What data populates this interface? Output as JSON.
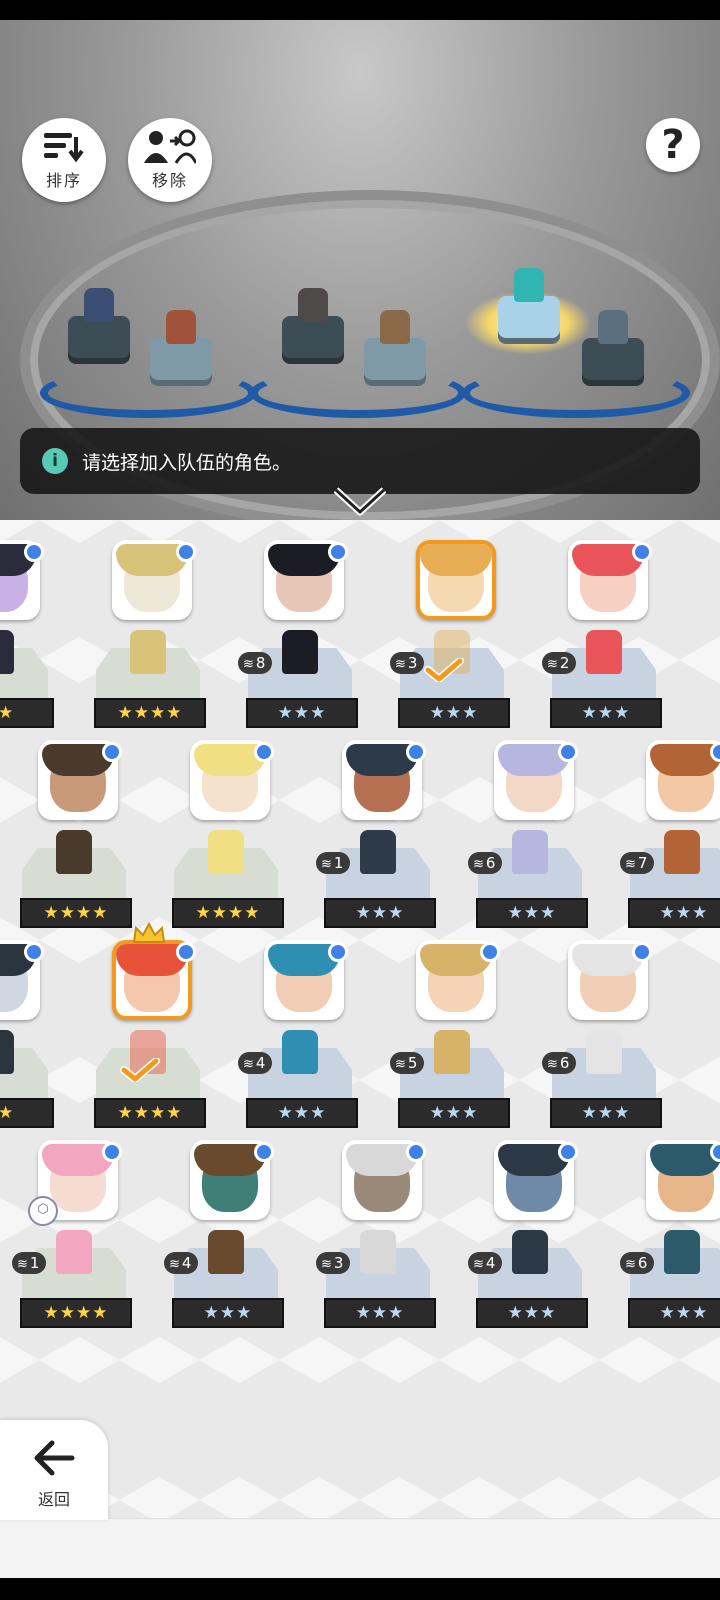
{
  "toolbar": {
    "sort_label": "排序",
    "remove_label": "移除",
    "help_label": "?"
  },
  "hint": {
    "text": "请选择加入队伍的角色。"
  },
  "back": {
    "label": "返回"
  },
  "colors": {
    "accent_orange": "#f39a1e",
    "new_dot_blue": "#3f82e6",
    "star_gold": "#ffd34a",
    "star_silver": "#b9d8f3"
  },
  "team_slots": [
    {
      "name": "slot-1-front",
      "occupied": true
    },
    {
      "name": "slot-1-back",
      "occupied": true
    },
    {
      "name": "slot-2-front",
      "occupied": true
    },
    {
      "name": "slot-2-back",
      "occupied": true
    },
    {
      "name": "slot-3-front",
      "occupied": true,
      "leader": true
    },
    {
      "name": "slot-3-back",
      "occupied": true
    }
  ],
  "rows": [
    {
      "cards": [
        {
          "stars": "★★",
          "rarity": "gold",
          "count": null,
          "selected": false,
          "new": true,
          "palette": [
            "#2b2b3b",
            "#c9b0e6"
          ]
        },
        {
          "stars": "★★★★",
          "rarity": "gold",
          "count": null,
          "selected": false,
          "new": true,
          "palette": [
            "#d9c27a",
            "#eee8d8"
          ]
        },
        {
          "stars": "★★★",
          "rarity": "silver",
          "count": "8",
          "selected": false,
          "new": true,
          "palette": [
            "#1c1c24",
            "#e8c6b6"
          ]
        },
        {
          "stars": "★★★",
          "rarity": "silver",
          "count": "3",
          "selected": true,
          "new": false,
          "palette": [
            "#e7ad54",
            "#f4d9b1"
          ]
        },
        {
          "stars": "★★★",
          "rarity": "silver",
          "count": "2",
          "selected": false,
          "new": true,
          "palette": [
            "#e9545b",
            "#f6d0c3"
          ]
        }
      ]
    },
    {
      "cards": [
        {
          "stars": "★★★★",
          "rarity": "gold",
          "count": null,
          "selected": false,
          "new": true,
          "palette": [
            "#4a3a2c",
            "#c89a7a"
          ]
        },
        {
          "stars": "★★★★",
          "rarity": "gold",
          "count": null,
          "selected": false,
          "new": true,
          "palette": [
            "#f1df84",
            "#f5e1cc"
          ]
        },
        {
          "stars": "★★★",
          "rarity": "silver",
          "count": "1",
          "selected": false,
          "new": true,
          "palette": [
            "#2d3a4a",
            "#b76f52"
          ]
        },
        {
          "stars": "★★★",
          "rarity": "silver",
          "count": "6",
          "selected": false,
          "new": true,
          "palette": [
            "#b7b6e0",
            "#f3d8c8"
          ]
        },
        {
          "stars": "★★★",
          "rarity": "silver",
          "count": "7",
          "selected": false,
          "new": true,
          "palette": [
            "#b26436",
            "#f2c8a5"
          ]
        }
      ]
    },
    {
      "cards": [
        {
          "stars": "★★",
          "rarity": "gold",
          "count": null,
          "selected": false,
          "new": true,
          "palette": [
            "#2b3540",
            "#cfd8e2"
          ]
        },
        {
          "stars": "★★★★",
          "rarity": "gold",
          "count": null,
          "selected": true,
          "new": true,
          "leader": true,
          "palette": [
            "#e8523b",
            "#f5c8ae"
          ]
        },
        {
          "stars": "★★★",
          "rarity": "silver",
          "count": "4",
          "selected": false,
          "new": true,
          "palette": [
            "#2f8fb2",
            "#f2cdb5"
          ]
        },
        {
          "stars": "★★★",
          "rarity": "silver",
          "count": "5",
          "selected": false,
          "new": true,
          "palette": [
            "#d7b36a",
            "#f4d3b6"
          ]
        },
        {
          "stars": "★★★",
          "rarity": "silver",
          "count": "6",
          "selected": false,
          "new": true,
          "palette": [
            "#e4e4e4",
            "#f0cfb6"
          ]
        }
      ]
    },
    {
      "cards": [
        {
          "stars": "★★★★",
          "rarity": "gold",
          "count": "1",
          "selected": false,
          "new": true,
          "upgrade": true,
          "palette": [
            "#f2a6c0",
            "#f6dcd0"
          ]
        },
        {
          "stars": "★★★",
          "rarity": "silver",
          "count": "4",
          "selected": false,
          "new": true,
          "palette": [
            "#6a4a2c",
            "#3f7f78"
          ]
        },
        {
          "stars": "★★★",
          "rarity": "silver",
          "count": "3",
          "selected": false,
          "new": true,
          "palette": [
            "#d8d8d8",
            "#9a8878"
          ]
        },
        {
          "stars": "★★★",
          "rarity": "silver",
          "count": "4",
          "selected": false,
          "new": true,
          "palette": [
            "#2b3846",
            "#6f8aa6"
          ]
        },
        {
          "stars": "★★★",
          "rarity": "silver",
          "count": "6",
          "selected": false,
          "new": true,
          "palette": [
            "#2c5a6a",
            "#e7b68a"
          ]
        }
      ]
    }
  ]
}
